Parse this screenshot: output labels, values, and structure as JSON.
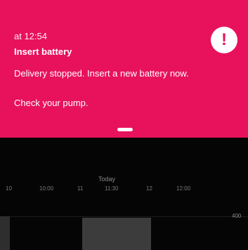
{
  "alert": {
    "time": "at 12:54",
    "title": "Insert battery",
    "message": "Delivery stopped. Insert a new battery now.",
    "action": "Check your pump.",
    "icon": "exclamation-icon",
    "icon_glyph": "!",
    "background_color": "#E8125C"
  },
  "timeline": {
    "today_label": "Today",
    "time_labels": [
      "10",
      "10:00",
      "11",
      "11:30",
      "12",
      "12:00"
    ],
    "y_value": "400"
  }
}
